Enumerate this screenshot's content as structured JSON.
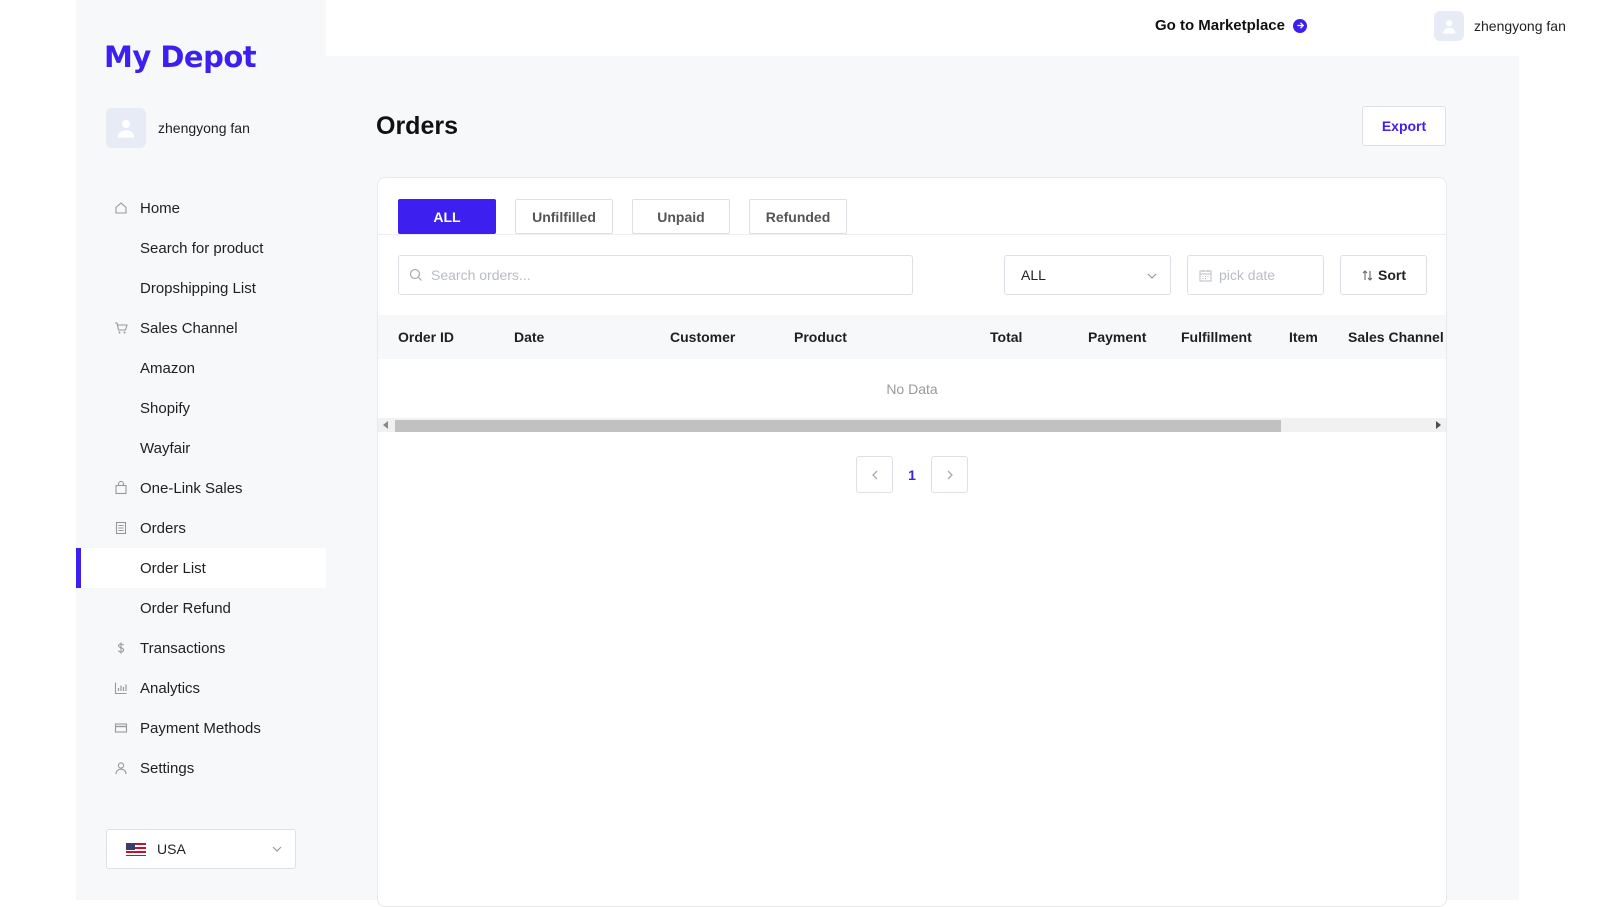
{
  "brand": {
    "logo_text": "My Depot",
    "accent_color": "#3d1ff0"
  },
  "user": {
    "name": "zhengyong fan",
    "avatar_icon": "user-icon"
  },
  "sidebar": {
    "items": [
      {
        "label": "Home",
        "icon": "home-icon"
      },
      {
        "label": "Search for product"
      },
      {
        "label": "Dropshipping List"
      },
      {
        "label": "Sales Channel",
        "icon": "cart-icon"
      },
      {
        "label": "Amazon"
      },
      {
        "label": "Shopify"
      },
      {
        "label": "Wayfair"
      },
      {
        "label": "One-Link Sales",
        "icon": "bag-icon"
      },
      {
        "label": "Orders",
        "icon": "document-icon"
      },
      {
        "label": "Order List",
        "active": true
      },
      {
        "label": "Order Refund"
      },
      {
        "label": "Transactions",
        "icon": "dollar-icon"
      },
      {
        "label": "Analytics",
        "icon": "bar-chart-icon"
      },
      {
        "label": "Payment Methods",
        "icon": "credit-card-icon"
      },
      {
        "label": "Settings",
        "icon": "user-icon"
      }
    ],
    "country": {
      "label": "USA",
      "flag_icon": "us-flag-icon"
    }
  },
  "topbar": {
    "marketplace_link": "Go to Marketplace",
    "marketplace_icon": "arrow-circle-right-icon"
  },
  "main": {
    "title": "Orders",
    "export_label": "Export",
    "tabs": [
      {
        "label": "ALL",
        "active": true
      },
      {
        "label": "Unfilfilled"
      },
      {
        "label": "Unpaid"
      },
      {
        "label": "Refunded"
      }
    ],
    "search": {
      "placeholder": "Search orders...",
      "value": ""
    },
    "status_filter": {
      "value": "ALL"
    },
    "date_picker": {
      "placeholder": "pick date"
    },
    "sort_label": "Sort",
    "table": {
      "columns": [
        "Order ID",
        "Date",
        "Customer",
        "Product",
        "Total",
        "Payment",
        "Fulfillment",
        "Item",
        "Sales Channel"
      ],
      "rows": [],
      "empty_text": "No Data"
    },
    "pagination": {
      "current_page": "1"
    }
  }
}
